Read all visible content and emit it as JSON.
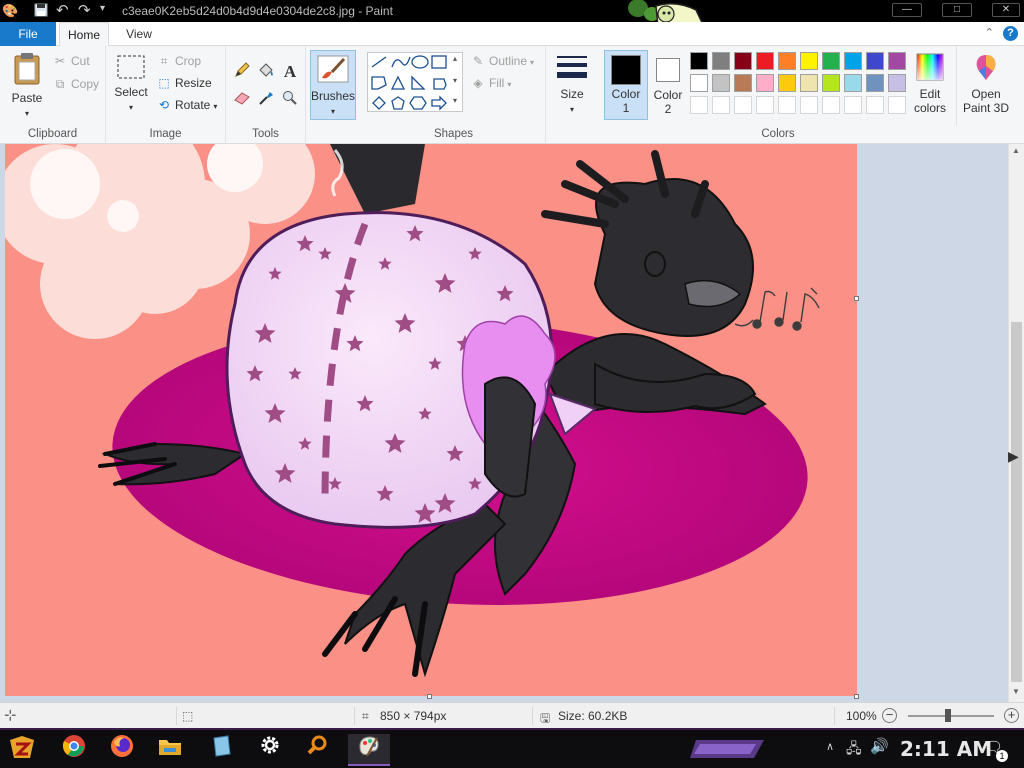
{
  "window": {
    "title": "c3eae0K2eb5d24d0b4d9d4e0304de2c8.jpg - Paint",
    "min": "—",
    "max": "□",
    "close": "✕"
  },
  "tabs": {
    "file": "File",
    "home": "Home",
    "view": "View"
  },
  "help": "?",
  "clipboard": {
    "paste": "Paste",
    "cut": "Cut",
    "copy": "Copy",
    "label": "Clipboard"
  },
  "image": {
    "select": "Select",
    "crop": "Crop",
    "resize": "Resize",
    "rotate": "Rotate",
    "label": "Image"
  },
  "tools": {
    "label": "Tools",
    "text_icon": "A"
  },
  "brushes": {
    "label": "Brushes"
  },
  "shapes": {
    "outline": "Outline",
    "fill": "Fill",
    "label": "Shapes"
  },
  "size": {
    "label": "Size"
  },
  "colors": {
    "color1": "Color",
    "color1_num": "1",
    "color2": "Color",
    "color2_num": "2",
    "edit": "Edit",
    "edit2": "colors",
    "paint3d": "Open",
    "paint3d2": "Paint 3D",
    "label": "Colors",
    "color1_value": "#000000",
    "color2_value": "#ffffff",
    "palette_row1": [
      "#000000",
      "#7f7f7f",
      "#880015",
      "#ed1c24",
      "#ff7f27",
      "#fff200",
      "#22b14c",
      "#00a2e8",
      "#3f48cc",
      "#a349a4"
    ],
    "palette_row2": [
      "#ffffff",
      "#c3c3c3",
      "#b97a57",
      "#ffaec9",
      "#ffc90e",
      "#efe4b0",
      "#b5e61d",
      "#99d9ea",
      "#7092be",
      "#c8bfe7"
    ]
  },
  "status": {
    "dimensions": "850 × 794px",
    "size": "Size: 60.2KB",
    "zoom": "100%",
    "zoom_out": "−",
    "zoom_in": "+"
  },
  "taskbar": {
    "clock": "2:11 AM",
    "notifications": "1"
  }
}
